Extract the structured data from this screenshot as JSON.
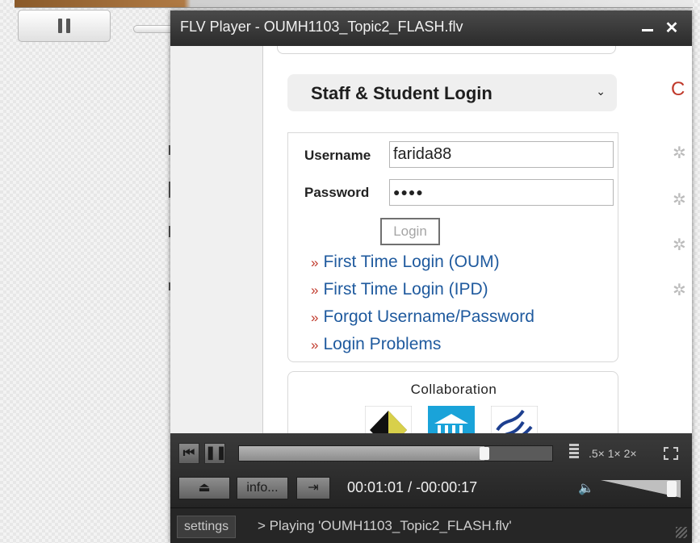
{
  "window": {
    "title": "FLV Player - OUMH1103_Topic2_FLASH.flv",
    "minimize_icon": "minimize-icon",
    "close_label": "✕"
  },
  "webpage": {
    "login_header": "Staff & Student Login",
    "username_label": "Username",
    "username_value": "farida88",
    "password_label": "Password",
    "password_value": "●●●●",
    "login_button": "Login",
    "links": [
      "First Time Login (OUM)",
      "First Time Login (IPD)",
      "Forgot Username/Password",
      "Login Problems"
    ],
    "link_prefix": "»",
    "collaboration_title": "Collaboration",
    "right_partial": "C"
  },
  "controls": {
    "seek_fraction": 0.78,
    "speed_options": ".5× 1× 2×",
    "info_button": "info...",
    "time_display": "00:01:01 / -00:00:17",
    "volume_fraction": 0.95
  },
  "status": {
    "settings_button": "settings",
    "text": "> Playing 'OUMH1103_Topic2_FLASH.flv'"
  },
  "colors": {
    "link": "#1f5a9e",
    "link_prefix": "#c0392b",
    "player_chrome": "#2a2a2a"
  }
}
